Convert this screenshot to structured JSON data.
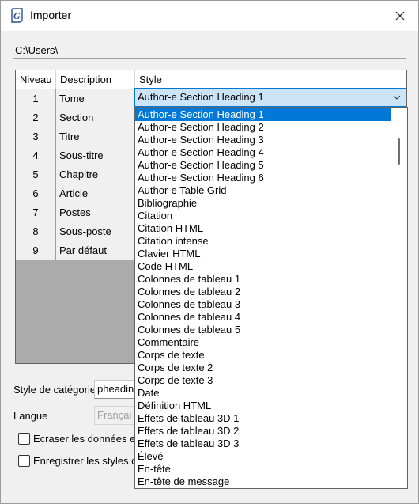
{
  "window": {
    "title": "Importer",
    "app_icon": "g-logo-icon",
    "close_icon": "close-icon"
  },
  "path": {
    "value": "C:\\Users\\"
  },
  "grid": {
    "columns": [
      "Niveau",
      "Description",
      "Style"
    ],
    "rows": [
      {
        "level": "1",
        "description": "Tome",
        "style": "Author-e Section Heading 1"
      },
      {
        "level": "2",
        "description": "Section",
        "style": ""
      },
      {
        "level": "3",
        "description": "Titre",
        "style": ""
      },
      {
        "level": "4",
        "description": "Sous-titre",
        "style": ""
      },
      {
        "level": "5",
        "description": "Chapitre",
        "style": ""
      },
      {
        "level": "6",
        "description": "Article",
        "style": ""
      },
      {
        "level": "7",
        "description": "Postes",
        "style": ""
      },
      {
        "level": "8",
        "description": "Sous-poste",
        "style": ""
      },
      {
        "level": "9",
        "description": "Par défaut",
        "style": ""
      }
    ]
  },
  "combo": {
    "value": "Author-e Section Heading 1",
    "arrow_icon": "chevron-down-icon"
  },
  "dropdown": {
    "selected_index": 0,
    "items": [
      "Author-e Section Heading 1",
      "Author-e Section Heading 2",
      "Author-e Section Heading 3",
      "Author-e Section Heading 4",
      "Author-e Section Heading 5",
      "Author-e Section Heading 6",
      "Author-e Table Grid",
      "Bibliographie",
      "Citation",
      "Citation HTML",
      "Citation intense",
      "Clavier HTML",
      "Code HTML",
      "Colonnes de tableau 1",
      "Colonnes de tableau 2",
      "Colonnes de tableau 3",
      "Colonnes de tableau 4",
      "Colonnes de tableau 5",
      "Commentaire",
      "Corps de texte",
      "Corps de texte 2",
      "Corps de texte 3",
      "Date",
      "Définition HTML",
      "Effets de tableau 3D 1",
      "Effets de tableau 3D 2",
      "Effets de tableau 3D 3",
      "Élevé",
      "En-tête",
      "En-tête de message"
    ]
  },
  "category_style": {
    "label": "Style de catégorie",
    "value": "pheadin"
  },
  "language": {
    "label": "Langue",
    "value": "Françai"
  },
  "options": {
    "overwrite_label": "Ecraser les données ex",
    "save_styles_label": "Enregistrer les styles d"
  }
}
